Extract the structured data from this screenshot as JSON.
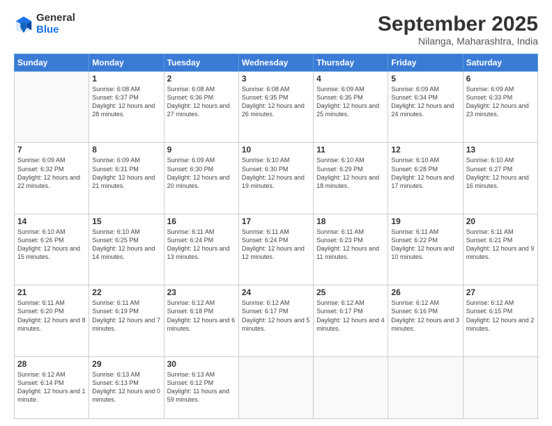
{
  "logo": {
    "general": "General",
    "blue": "Blue"
  },
  "header": {
    "month": "September 2025",
    "location": "Nilanga, Maharashtra, India"
  },
  "weekdays": [
    "Sunday",
    "Monday",
    "Tuesday",
    "Wednesday",
    "Thursday",
    "Friday",
    "Saturday"
  ],
  "weeks": [
    [
      {
        "day": "",
        "info": ""
      },
      {
        "day": "1",
        "info": "Sunrise: 6:08 AM\nSunset: 6:37 PM\nDaylight: 12 hours\nand 28 minutes."
      },
      {
        "day": "2",
        "info": "Sunrise: 6:08 AM\nSunset: 6:36 PM\nDaylight: 12 hours\nand 27 minutes."
      },
      {
        "day": "3",
        "info": "Sunrise: 6:08 AM\nSunset: 6:35 PM\nDaylight: 12 hours\nand 26 minutes."
      },
      {
        "day": "4",
        "info": "Sunrise: 6:09 AM\nSunset: 6:35 PM\nDaylight: 12 hours\nand 25 minutes."
      },
      {
        "day": "5",
        "info": "Sunrise: 6:09 AM\nSunset: 6:34 PM\nDaylight: 12 hours\nand 24 minutes."
      },
      {
        "day": "6",
        "info": "Sunrise: 6:09 AM\nSunset: 6:33 PM\nDaylight: 12 hours\nand 23 minutes."
      }
    ],
    [
      {
        "day": "7",
        "info": "Sunrise: 6:09 AM\nSunset: 6:32 PM\nDaylight: 12 hours\nand 22 minutes."
      },
      {
        "day": "8",
        "info": "Sunrise: 6:09 AM\nSunset: 6:31 PM\nDaylight: 12 hours\nand 21 minutes."
      },
      {
        "day": "9",
        "info": "Sunrise: 6:09 AM\nSunset: 6:30 PM\nDaylight: 12 hours\nand 20 minutes."
      },
      {
        "day": "10",
        "info": "Sunrise: 6:10 AM\nSunset: 6:30 PM\nDaylight: 12 hours\nand 19 minutes."
      },
      {
        "day": "11",
        "info": "Sunrise: 6:10 AM\nSunset: 6:29 PM\nDaylight: 12 hours\nand 18 minutes."
      },
      {
        "day": "12",
        "info": "Sunrise: 6:10 AM\nSunset: 6:28 PM\nDaylight: 12 hours\nand 17 minutes."
      },
      {
        "day": "13",
        "info": "Sunrise: 6:10 AM\nSunset: 6:27 PM\nDaylight: 12 hours\nand 16 minutes."
      }
    ],
    [
      {
        "day": "14",
        "info": "Sunrise: 6:10 AM\nSunset: 6:26 PM\nDaylight: 12 hours\nand 15 minutes."
      },
      {
        "day": "15",
        "info": "Sunrise: 6:10 AM\nSunset: 6:25 PM\nDaylight: 12 hours\nand 14 minutes."
      },
      {
        "day": "16",
        "info": "Sunrise: 6:11 AM\nSunset: 6:24 PM\nDaylight: 12 hours\nand 13 minutes."
      },
      {
        "day": "17",
        "info": "Sunrise: 6:11 AM\nSunset: 6:24 PM\nDaylight: 12 hours\nand 12 minutes."
      },
      {
        "day": "18",
        "info": "Sunrise: 6:11 AM\nSunset: 6:23 PM\nDaylight: 12 hours\nand 11 minutes."
      },
      {
        "day": "19",
        "info": "Sunrise: 6:11 AM\nSunset: 6:22 PM\nDaylight: 12 hours\nand 10 minutes."
      },
      {
        "day": "20",
        "info": "Sunrise: 6:11 AM\nSunset: 6:21 PM\nDaylight: 12 hours\nand 9 minutes."
      }
    ],
    [
      {
        "day": "21",
        "info": "Sunrise: 6:11 AM\nSunset: 6:20 PM\nDaylight: 12 hours\nand 8 minutes."
      },
      {
        "day": "22",
        "info": "Sunrise: 6:11 AM\nSunset: 6:19 PM\nDaylight: 12 hours\nand 7 minutes."
      },
      {
        "day": "23",
        "info": "Sunrise: 6:12 AM\nSunset: 6:18 PM\nDaylight: 12 hours\nand 6 minutes."
      },
      {
        "day": "24",
        "info": "Sunrise: 6:12 AM\nSunset: 6:17 PM\nDaylight: 12 hours\nand 5 minutes."
      },
      {
        "day": "25",
        "info": "Sunrise: 6:12 AM\nSunset: 6:17 PM\nDaylight: 12 hours\nand 4 minutes."
      },
      {
        "day": "26",
        "info": "Sunrise: 6:12 AM\nSunset: 6:16 PM\nDaylight: 12 hours\nand 3 minutes."
      },
      {
        "day": "27",
        "info": "Sunrise: 6:12 AM\nSunset: 6:15 PM\nDaylight: 12 hours\nand 2 minutes."
      }
    ],
    [
      {
        "day": "28",
        "info": "Sunrise: 6:12 AM\nSunset: 6:14 PM\nDaylight: 12 hours\nand 1 minute."
      },
      {
        "day": "29",
        "info": "Sunrise: 6:13 AM\nSunset: 6:13 PM\nDaylight: 12 hours\nand 0 minutes."
      },
      {
        "day": "30",
        "info": "Sunrise: 6:13 AM\nSunset: 6:12 PM\nDaylight: 11 hours\nand 59 minutes."
      },
      {
        "day": "",
        "info": ""
      },
      {
        "day": "",
        "info": ""
      },
      {
        "day": "",
        "info": ""
      },
      {
        "day": "",
        "info": ""
      }
    ]
  ]
}
